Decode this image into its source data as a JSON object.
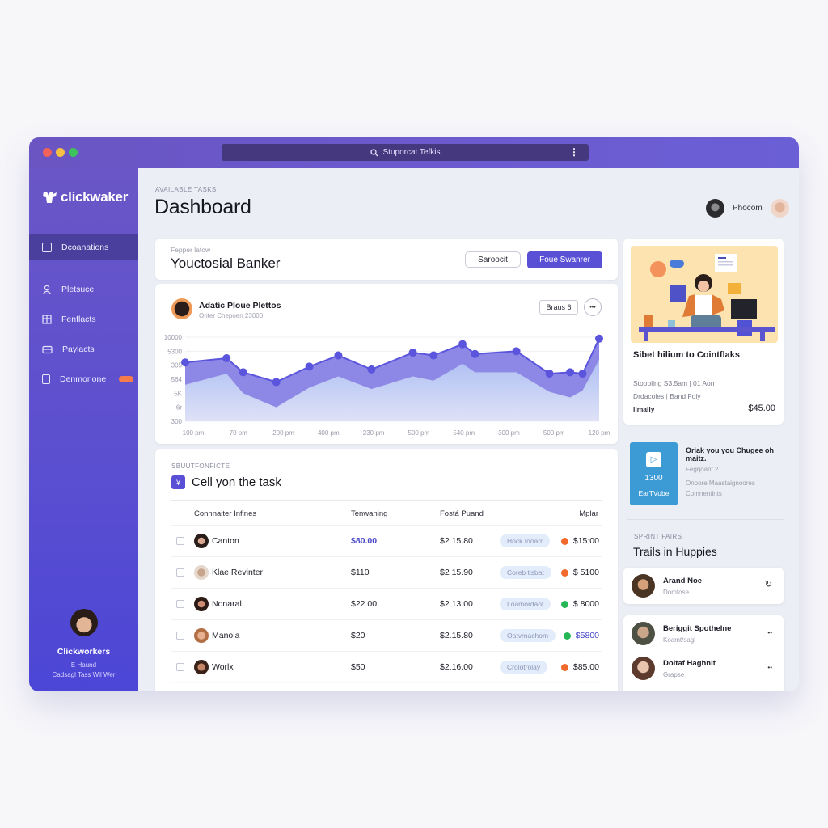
{
  "window": {
    "search_label": "Stuporcat Tefkis",
    "traffic_colors": [
      "#f0625a",
      "#f5c043",
      "#3dc25c"
    ]
  },
  "sidebar": {
    "logo": "clickwaker",
    "items": [
      {
        "label": "Dcoanations",
        "active": true
      },
      {
        "label": "Pletsuce",
        "active": false
      },
      {
        "label": "Fenflacts",
        "active": false
      },
      {
        "label": "Paylacts",
        "active": false
      },
      {
        "label": "Denmorlone",
        "active": false,
        "badge": true
      }
    ],
    "profile": {
      "name": "Clickworkers",
      "line1": "E Haund",
      "line2": "Cadsagl Tass Wil Wer"
    }
  },
  "header": {
    "eyebrow": "AVAILABLE TASKS",
    "title": "Dashboard",
    "user_label": "Phocom"
  },
  "task_banner": {
    "eyebrow": "Fepper latow",
    "title": "Youctosial Banker",
    "secondary_button": "Saroocit",
    "primary_button": "Foue Swanrer"
  },
  "chart_card": {
    "name": "Adatic Ploue Plettos",
    "subtitle": "Onter Chepoen 23000",
    "filter_button": "Braus 6",
    "more_label": "•••"
  },
  "chart_data": {
    "type": "area",
    "title": "Adatic Ploue Plettos",
    "xlabel": "",
    "ylabel": "",
    "ytick_labels": [
      "10000",
      "5300",
      "305",
      "564",
      "5K",
      "6r",
      "300"
    ],
    "xtick_labels": [
      "100 pm",
      "70 pm",
      "200 pm",
      "400 pm",
      "230 pm",
      "500 pm",
      "540 pm",
      "300 pm",
      "500 pm",
      "120 pm"
    ],
    "ylim": [
      0,
      6
    ],
    "grid": true,
    "legend": "none",
    "series": [
      {
        "name": "upper",
        "x": [
          0,
          0.1,
          0.14,
          0.22,
          0.3,
          0.37,
          0.45,
          0.55,
          0.6,
          0.67,
          0.7,
          0.8,
          0.88,
          0.93,
          0.96,
          1.0
        ],
        "values": [
          4.2,
          4.5,
          3.5,
          2.8,
          3.9,
          4.7,
          3.7,
          4.9,
          4.7,
          5.5,
          4.8,
          5.0,
          3.4,
          3.5,
          3.4,
          5.9
        ],
        "color": "#5a55dc"
      },
      {
        "name": "lower",
        "x": [
          0,
          0.1,
          0.14,
          0.22,
          0.3,
          0.37,
          0.45,
          0.55,
          0.6,
          0.67,
          0.7,
          0.8,
          0.88,
          0.93,
          0.96,
          1.0
        ],
        "values": [
          2.6,
          3.4,
          2.0,
          1.0,
          2.4,
          3.2,
          2.3,
          3.2,
          2.9,
          4.1,
          3.5,
          3.5,
          2.1,
          1.7,
          2.2,
          4.4
        ],
        "color": "#b7c7f4"
      }
    ]
  },
  "task_table": {
    "eyebrow": "SBUUTFONFICTE",
    "title": "Cell yon the task",
    "columns": [
      "Connnaiter Infines",
      "Tenwaning",
      "Fostá Puand",
      "Mplar"
    ],
    "rows": [
      {
        "name": "Canton",
        "amount": "$80.00",
        "amount_highlight": true,
        "total": "$2 15.80",
        "tag": "Hock Iooarr",
        "status_color": "#f26a2b",
        "value": "$15:00",
        "value_highlight": false
      },
      {
        "name": "Klae Revinter",
        "amount": "$110",
        "amount_highlight": false,
        "total": "$2 15.90",
        "tag": "Coreb tisbat",
        "status_color": "#f26a2b",
        "value": "$ 5100",
        "value_highlight": false
      },
      {
        "name": "Nonaral",
        "amount": "$22.00",
        "amount_highlight": false,
        "total": "$2 13.00",
        "tag": "Loamordaot",
        "status_color": "#27b656",
        "value": "$ 8000",
        "value_highlight": false
      },
      {
        "name": "Manola",
        "amount": "$20",
        "amount_highlight": false,
        "total": "$2.15.80",
        "tag": "Oatvrnachom",
        "status_color": "#27b656",
        "value": "$5800",
        "value_highlight": true
      },
      {
        "name": "Worlx",
        "amount": "$50",
        "amount_highlight": false,
        "total": "$2.16.00",
        "tag": "Crolotrolay",
        "status_color": "#f26a2b",
        "value": "$85.00",
        "value_highlight": false
      }
    ]
  },
  "promo_card": {
    "title": "Sibet hilium to Cointflaks",
    "meta1": "Stoopling S3.5am  |  01 Aon",
    "meta2": "Drdacoles | Band Foly",
    "footer_label": "limally",
    "price": "$45.00"
  },
  "video_card": {
    "count": "1300",
    "label": "EarTVube",
    "title": "Oriak you you Chugee oh maitz.",
    "sub1": "Fegrjoant 2",
    "sub2": "Onoore Maastaignoores Comnentints"
  },
  "people": {
    "eyebrow": "SPRINT FAIRS",
    "title": "Trails in Huppies",
    "list": [
      {
        "name": "Arand Noe",
        "role": "Domfose",
        "action": "↻"
      },
      {
        "name": "Beriggit Spothelne",
        "role": "Koamt/sagl",
        "action": "••"
      },
      {
        "name": "Doltaf Haghnit",
        "role": "Grapse",
        "action": "••"
      }
    ]
  }
}
